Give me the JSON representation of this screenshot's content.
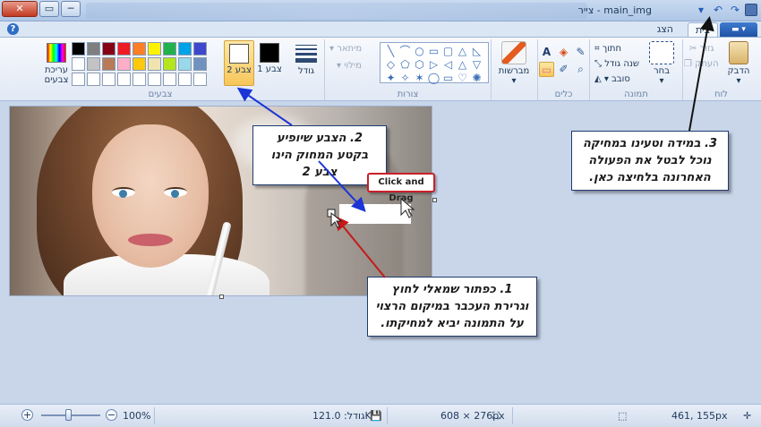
{
  "window": {
    "title": "main_img - צייר",
    "close_label": "✕",
    "maximize_label": "▭",
    "minimize_label": "─"
  },
  "quick_access": {
    "undo_glyph": "↶",
    "redo_glyph": "↷",
    "dropdown_glyph": "▾"
  },
  "ribbon_tabs": {
    "menu_label": "▬ ▾",
    "home": "בית",
    "view": "הצג",
    "help_glyph": "?"
  },
  "groups": {
    "clipboard": "לוח",
    "image": "תמונה",
    "tools": "כלים",
    "shapes": "צורות",
    "colors": "צבעים"
  },
  "clipboard": {
    "paste_label": "הדבק",
    "cut_label": "גזור",
    "copy_label": "העתק"
  },
  "image": {
    "select_label": "בחר",
    "crop_label": "חתוך",
    "resize_label": "שנה גודל",
    "rotate_label": "סובב"
  },
  "tools": {
    "pencil": "✎",
    "fill": "◈",
    "text": "A",
    "eraser": "▭",
    "picker": "✐",
    "magnifier": "⌕"
  },
  "brushes": {
    "label": "מברשות"
  },
  "shape_options": {
    "outline_label": "מיתאר",
    "fill_label": "מילוי"
  },
  "shapes": [
    "╲",
    "⌒",
    "○",
    "▭",
    "▢",
    "△",
    "◺",
    "◇",
    "⬠",
    "⬡",
    "▷",
    "◁",
    "△",
    "▽",
    "✦",
    "✧",
    "✶",
    "◯",
    "▭",
    "♡",
    "✺"
  ],
  "size": {
    "label": "גודל"
  },
  "color_slots": {
    "color1_label": "צבע 1",
    "color2_label": "צבע 2",
    "color1_value": "#000000",
    "color2_value": "#ffffff"
  },
  "edit_colors": {
    "label": "עריכת צבעים"
  },
  "palette": [
    "#000000",
    "#7f7f7f",
    "#880015",
    "#ed1c24",
    "#ff7f27",
    "#fff200",
    "#22b14c",
    "#00a2e8",
    "#3f48cc",
    "#ffffff",
    "#c3c3c3",
    "#b97a57",
    "#ffaec9",
    "#ffc90e",
    "#efe4b0",
    "#b5e61d",
    "#99d9ea",
    "#7092be",
    "#ffffff",
    "#ffffff",
    "#ffffff",
    "#ffffff",
    "#ffffff",
    "#ffffff",
    "#ffffff",
    "#ffffff",
    "#ffffff"
  ],
  "callouts": {
    "step1": "1. כפתור שמאלי לחוץ וגרירת העכבר במיקום הרצוי על התמונה יביא למחיקתו.",
    "step2": "2. הצבע שיופיע בקטע המחוק הינו צבע 2",
    "step3": "3. במידה וטעינו במחיקה נוכל לבטל את הפעולה האחרונה בלחיצה כאן.",
    "click_drag": "Click and Drag"
  },
  "status": {
    "cursor_position": "461, 155px",
    "image_dimensions": "608 × 276px",
    "file_size": "גודל: 121.0KB",
    "zoom_level": "100%",
    "zoom_in": "+",
    "zoom_out": "−"
  },
  "colors": {
    "accent": "#1e5bb8",
    "callout_red": "#c8202a",
    "arrow_blue": "#1b35d6",
    "arrow_red": "#c41a1a",
    "arrow_black": "#111111"
  }
}
